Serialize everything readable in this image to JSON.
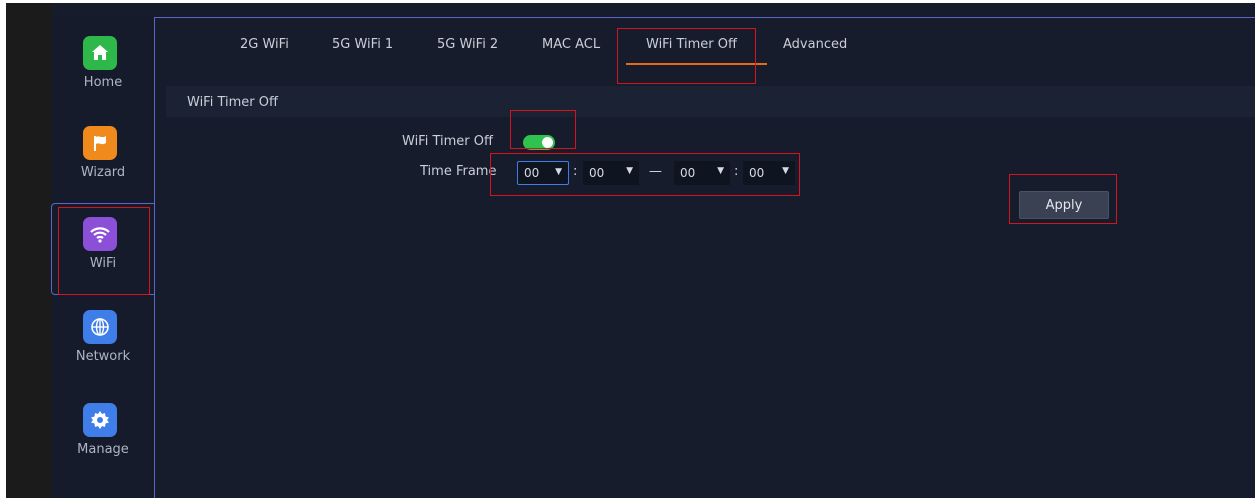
{
  "sidebar": {
    "items": [
      {
        "label": "Home",
        "color": "#2fb84a",
        "icon": "home-icon"
      },
      {
        "label": "Wizard",
        "color": "#f08a1c",
        "icon": "flag-icon"
      },
      {
        "label": "WiFi",
        "color": "#8b4fd8",
        "icon": "wifi-icon",
        "active": true
      },
      {
        "label": "Network",
        "color": "#3f7ee8",
        "icon": "globe-icon"
      },
      {
        "label": "Manage",
        "color": "#3f7ee8",
        "icon": "gear-icon"
      }
    ]
  },
  "tabs": [
    {
      "label": "2G WiFi"
    },
    {
      "label": "5G WiFi 1"
    },
    {
      "label": "5G WiFi 2"
    },
    {
      "label": "MAC ACL"
    },
    {
      "label": "WiFi Timer Off",
      "active": true
    },
    {
      "label": "Advanced"
    }
  ],
  "section": {
    "title": "WiFi Timer Off"
  },
  "form": {
    "timer_label": "WiFi Timer Off",
    "timer_enabled": true,
    "timeframe_label": "Time Frame",
    "start_hour": "00",
    "start_minute": "00",
    "end_hour": "00",
    "end_minute": "00",
    "colon": ":",
    "dash": "—",
    "arrow": "▼",
    "apply_label": "Apply"
  },
  "colors": {
    "accent": "#e8691a",
    "toggle_on": "#2fc24e",
    "highlight_box": "#d4151b"
  }
}
